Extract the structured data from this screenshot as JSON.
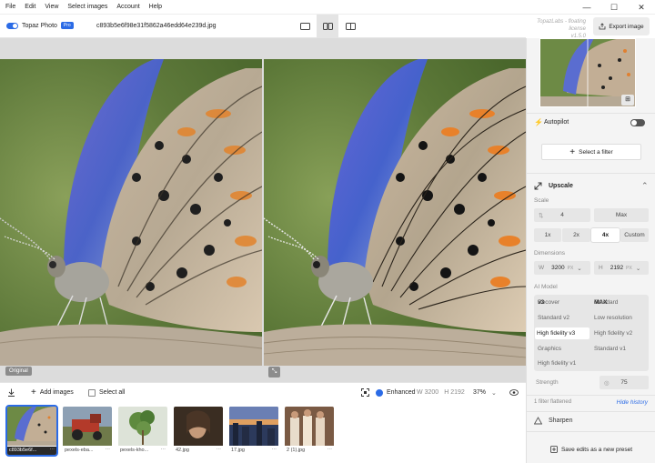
{
  "menu": {
    "items": [
      "File",
      "Edit",
      "View",
      "Select images",
      "Account",
      "Help"
    ]
  },
  "toolbar": {
    "brand": "Topaz Photo",
    "badge": "Pro",
    "filename": "c893b5e6f98e31f5862a46edd64e239d.jpg",
    "license_line1": "TopazLabs - floating license",
    "license_line2": "v1.5.0",
    "export_label": "Export image"
  },
  "canvas": {
    "original_label": "Original"
  },
  "strip": {
    "add_images": "Add images",
    "select_all": "Select all",
    "enhanced": "Enhanced",
    "w_label": "W",
    "w_value": "3200",
    "h_label": "H",
    "h_value": "2192",
    "zoom": "37%"
  },
  "thumbnails": [
    {
      "name": "c893b5e6f...",
      "selected": true
    },
    {
      "name": "pexels-eba...",
      "selected": false
    },
    {
      "name": "pexels-kho...",
      "selected": false
    },
    {
      "name": "42.jpg",
      "selected": false
    },
    {
      "name": "17.jpg",
      "selected": false
    },
    {
      "name": "2 (1).jpg",
      "selected": false
    }
  ],
  "panel": {
    "autopilot": "Autopilot",
    "select_filter": "Select a filter",
    "upscale": {
      "title": "Upscale",
      "scale_label": "Scale",
      "scale_value": "4",
      "max_label": "Max",
      "scale_options": [
        "1x",
        "2x",
        "4x",
        "Custom"
      ],
      "scale_selected": "4x",
      "dimensions_label": "Dimensions",
      "width_prefix": "W",
      "width_value": "3200",
      "height_prefix": "H",
      "height_value": "2192",
      "unit": "PX",
      "ai_model_label": "AI Model",
      "models": {
        "recover": "Recover",
        "recover_ver": "v3",
        "standard": "Standard",
        "standard_ver": "MAX",
        "standard_v2": "Standard v2",
        "low_resolution": "Low resolution",
        "high_fidelity_v3": "High fidelity v3",
        "high_fidelity_v2": "High fidelity v2",
        "graphics": "Graphics",
        "standard_v1": "Standard v1",
        "high_fidelity_v1": "High fidelity v1"
      },
      "selected_model": "High fidelity v3",
      "strength_label": "Strength",
      "strength_value": "75"
    },
    "filters_flattened": "1 filter flattened",
    "hide_history": "Hide history",
    "sharpen": "Sharpen",
    "save_preset": "Save edits as a new preset"
  },
  "colors": {
    "accent": "#2b6be6",
    "toggle_off": "#555555"
  }
}
